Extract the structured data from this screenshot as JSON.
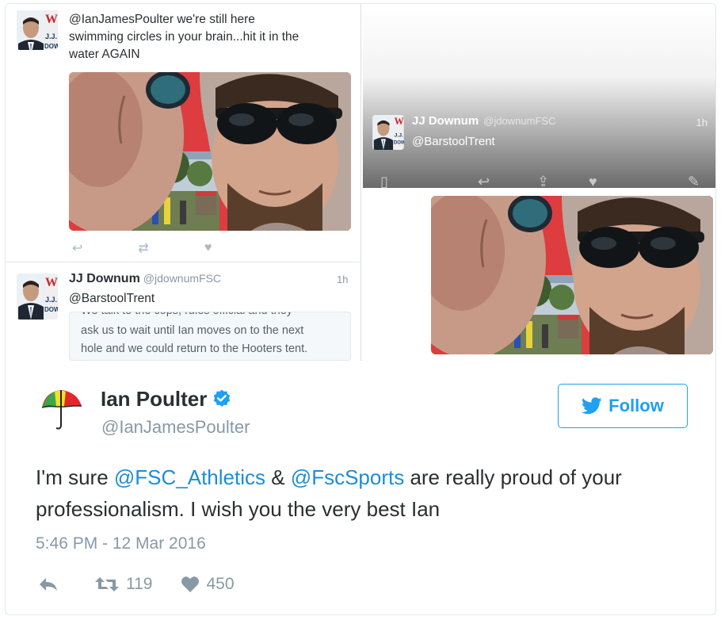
{
  "panel_a": {
    "reply_text": [
      "@IanJamesPoulter we're still here",
      "swimming circles in your brain...hit it in the",
      "water AGAIN"
    ],
    "tweet2": {
      "name": "JJ Downum",
      "handle": "@jdownumFSC",
      "time": "1h",
      "text": "@BarstoolTrent",
      "quote_lines": [
        "We talk to the cops, rules official and they",
        "ask us to wait until Ian moves on to the next",
        "hole and we could return to the Hooters tent."
      ]
    }
  },
  "panel_b": {
    "name": "JJ Downum",
    "handle": "@jdownumFSC",
    "time": "1h",
    "text": "@BarstoolTrent"
  },
  "tweet": {
    "name": "Ian Poulter",
    "handle": "@IanJamesPoulter",
    "follow_label": "Follow",
    "body_prefix": "I'm sure ",
    "mention1": "@FSC_Athletics",
    "body_mid": " & ",
    "mention2": "@FscSports",
    "body_suffix": " are really proud of your professionalism. I wish you the very best Ian",
    "timestamp": "5:46 PM - 12 Mar 2016",
    "retweets": "119",
    "likes": "450"
  },
  "colors": {
    "accent": "#1da1f2",
    "mention": "#1d8dd6",
    "muted": "#8899a6",
    "text": "#292f33"
  },
  "icons": [
    "verified-badge-icon",
    "twitter-bird-icon",
    "reply-icon",
    "retweet-icon",
    "heart-icon",
    "umbrella-logo"
  ]
}
